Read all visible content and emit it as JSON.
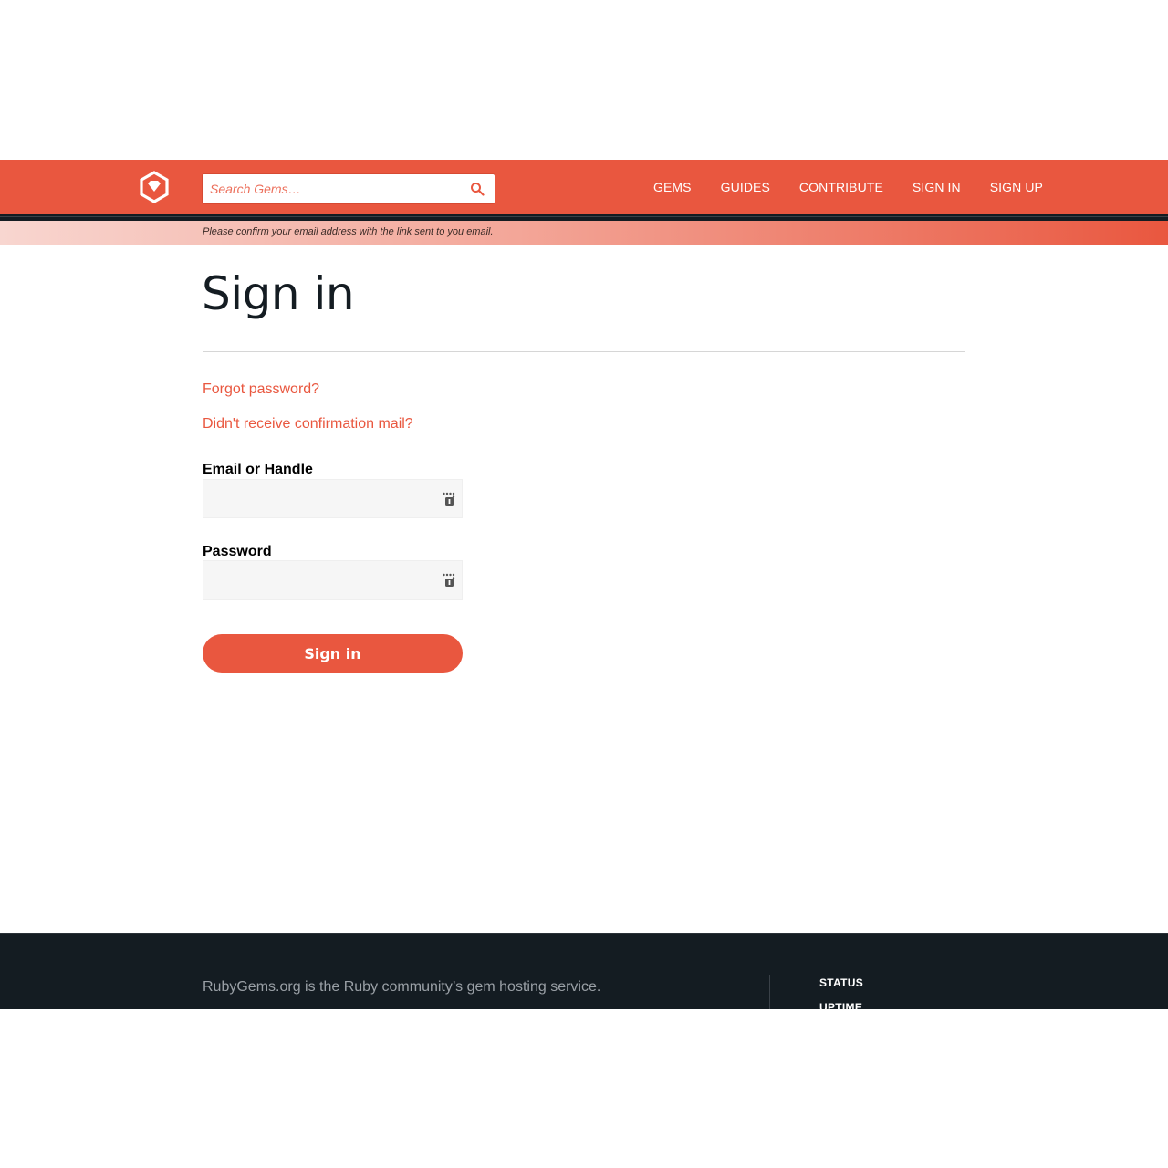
{
  "header": {
    "search_placeholder": "Search Gems…",
    "nav": {
      "gems": "GEMS",
      "guides": "GUIDES",
      "contribute": "CONTRIBUTE",
      "sign_in": "SIGN IN",
      "sign_up": "SIGN UP"
    }
  },
  "flash": {
    "message": "Please confirm your email address with the link sent to you email."
  },
  "main": {
    "title": "Sign in",
    "forgot_password": "Forgot password?",
    "no_confirmation": "Didn't receive confirmation mail?",
    "email_label": "Email or Handle",
    "email_value": "",
    "password_label": "Password",
    "password_value": "",
    "submit_label": "Sign in"
  },
  "footer": {
    "description": "RubyGems.org is the Ruby community’s gem hosting service.",
    "links": {
      "status": "STATUS",
      "uptime": "UPTIME"
    }
  },
  "colors": {
    "brand": "#e9573f",
    "dark": "#141c22"
  },
  "icons": {
    "logo": "rubygems-logo-icon",
    "search": "search-icon",
    "password_manager": "password-manager-icon"
  }
}
